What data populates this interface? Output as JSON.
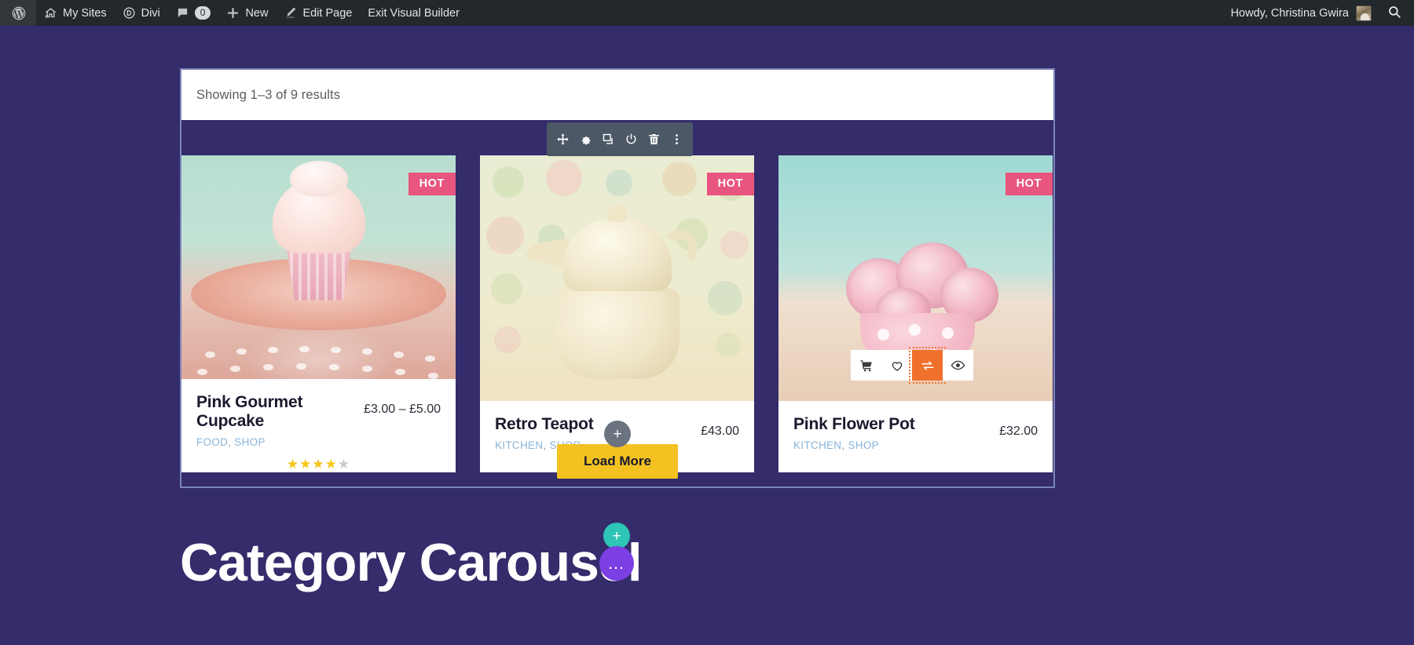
{
  "adminbar": {
    "wp_logo": "wordpress-icon",
    "items": [
      {
        "label": "My Sites",
        "icon": "sites-icon"
      },
      {
        "label": "Divi",
        "icon": "divi-icon"
      },
      {
        "label": "0",
        "icon": "comment-icon"
      },
      {
        "label": "New",
        "icon": "plus-icon"
      },
      {
        "label": "Edit Page",
        "icon": "pencil-icon"
      },
      {
        "label": "Exit Visual Builder",
        "icon": "none"
      }
    ],
    "howdy": "Howdy, Christina Gwira",
    "avatar": "avatar",
    "search": "search-icon"
  },
  "module": {
    "results_text": "Showing 1–3 of 9 results",
    "toolbar": [
      {
        "name": "move-handle-icon",
        "glyph": "✛"
      },
      {
        "name": "gear-settings-icon",
        "glyph": "⚙"
      },
      {
        "name": "duplicate-icon",
        "glyph": "⧉"
      },
      {
        "name": "disable-power-icon",
        "glyph": "⏻"
      },
      {
        "name": "trash-delete-icon",
        "glyph": "Ὕ1"
      },
      {
        "name": "more-options-icon",
        "glyph": "⋮"
      }
    ]
  },
  "products": [
    {
      "title": "Pink Gourmet Cupcake",
      "price": "£3.00 – £5.00",
      "badge": "HOT",
      "categories": [
        "FOOD",
        "SHOP"
      ],
      "rating": 4,
      "rating_max": 5,
      "image": "cupcake-on-polka-dot-plate",
      "has_rating": true,
      "has_hover_actions": false
    },
    {
      "title": "Retro Teapot",
      "price": "£43.00",
      "badge": "HOT",
      "categories": [
        "KITCHEN",
        "SHOP"
      ],
      "rating": 0,
      "rating_max": 5,
      "image": "retro-teapot-on-polka-dot-background",
      "has_rating": false,
      "has_hover_actions": false
    },
    {
      "title": "Pink Flower Pot",
      "price": "£32.00",
      "badge": "HOT",
      "categories": [
        "KITCHEN",
        "SHOP"
      ],
      "rating": 0,
      "rating_max": 5,
      "image": "pink-roses-in-polka-dot-pot",
      "has_rating": false,
      "has_hover_actions": true,
      "hover_actions": [
        {
          "name": "add-to-cart-icon",
          "glyph": "🛒",
          "active": false
        },
        {
          "name": "wishlist-heart-icon",
          "glyph": "♡",
          "active": false
        },
        {
          "name": "compare-icon",
          "glyph": "⇄",
          "active": true
        },
        {
          "name": "quick-view-eye-icon",
          "glyph": "👁",
          "active": false
        }
      ]
    }
  ],
  "load_more": {
    "label": "Load More",
    "add_module_label": "+",
    "color": "#f3c221"
  },
  "builder": {
    "add_row_label": "+",
    "add_section_label": "…"
  },
  "section": {
    "heading": "Category Carousel"
  },
  "colors": {
    "page_background": "#342c6b",
    "admin_bar": "#23282d",
    "badge_hot": "#e8557f",
    "button_primary": "#f3c221",
    "accent_orange": "#f0712c",
    "teal": "#2ec4b6",
    "purple": "#7b3fe4",
    "star_gold": "#f5c518"
  }
}
